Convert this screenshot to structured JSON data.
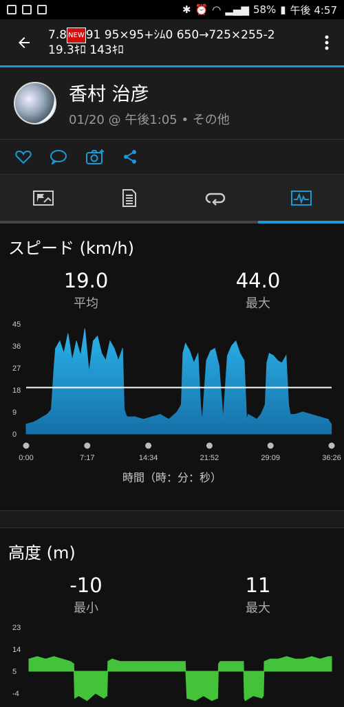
{
  "statusbar": {
    "battery": "58%",
    "time": "午後 4:57"
  },
  "appbar": {
    "title_line1_a": "7.8",
    "new_badge": "NEW",
    "title_line1_b": "91 95×95+ｼﾑ0 650→725×255-2",
    "title_line2": "19.3ｷﾛ 143ｷﾛ"
  },
  "profile": {
    "name": "香村 治彦",
    "meta": "01/20 @ 午後1:05 • その他"
  },
  "speed": {
    "title": "スピード (km/h)",
    "avg_value": "19.0",
    "avg_label": "平均",
    "max_value": "44.0",
    "max_label": "最大",
    "xaxis_title": "時間（時：分：秒）"
  },
  "altitude": {
    "title": "高度 (m)",
    "min_value": "-10",
    "min_label": "最小",
    "max_value": "11",
    "max_label": "最大"
  },
  "colors": {
    "accent": "#1a9ad6",
    "speed_fill": "#1a9ad6",
    "alt_fill": "#44c23a"
  },
  "chart_data": [
    {
      "type": "area",
      "ylim": [
        0,
        45
      ],
      "yticks": [
        "45",
        "36",
        "27",
        "18",
        "9",
        "0"
      ],
      "xticks": [
        "0:00",
        "7:17",
        "14:34",
        "21:52",
        "29:09",
        "36:26"
      ],
      "average_line": 19,
      "xmax": 36.43,
      "x": [
        0,
        1,
        2,
        2.5,
        3,
        3.3,
        3.5,
        4,
        4.5,
        5,
        5.5,
        6,
        6.5,
        7,
        7.5,
        8,
        8.5,
        9,
        9.5,
        10,
        10.5,
        11,
        11.5,
        11.7,
        12,
        13,
        14,
        15,
        16,
        17,
        18,
        18.5,
        18.7,
        19,
        19.5,
        20,
        20.5,
        20.8,
        21,
        21.5,
        22,
        22.5,
        23,
        23.5,
        24,
        24.5,
        25,
        25.5,
        26,
        26.3,
        26.5,
        27,
        27.5,
        28,
        28.5,
        28.7,
        29,
        29.5,
        30,
        30.5,
        31,
        31.3,
        31.5,
        32,
        33,
        34,
        35,
        36,
        36.4
      ],
      "values": [
        4,
        5,
        7,
        8,
        10,
        26,
        35,
        38,
        33,
        41,
        30,
        38,
        32,
        43,
        25,
        38,
        40,
        33,
        30,
        38,
        35,
        30,
        35,
        10,
        7,
        7,
        6,
        7,
        8,
        6,
        9,
        12,
        33,
        37,
        34,
        29,
        33,
        12,
        5,
        30,
        34,
        35,
        28,
        6,
        32,
        36,
        38,
        33,
        30,
        6,
        8,
        7,
        6,
        8,
        12,
        29,
        33,
        32,
        30,
        29,
        32,
        12,
        8,
        8,
        9,
        8,
        7,
        6,
        4
      ]
    },
    {
      "type": "area",
      "ylim": [
        -4,
        23
      ],
      "yticks": [
        "23",
        "14",
        "5",
        "-4"
      ],
      "x": [
        0,
        1,
        2,
        3,
        4,
        5,
        5.4,
        5.5,
        6,
        7,
        8,
        9,
        9.4,
        9.5,
        10,
        11,
        12,
        13,
        14,
        15,
        16,
        17,
        18,
        18.8,
        19,
        20,
        21,
        22,
        22.7,
        22.8,
        23,
        24,
        25,
        25.8,
        25.9,
        26,
        27,
        28,
        28.2,
        28.3,
        29,
        30,
        31,
        32,
        33,
        34,
        35,
        36,
        36.4
      ],
      "values": [
        10,
        11,
        10,
        11,
        10,
        9,
        8,
        -6,
        -5,
        -7,
        -4,
        -6,
        -5,
        9,
        10,
        9,
        9,
        9,
        9,
        9,
        9,
        9,
        9,
        9,
        -6,
        -7,
        -5,
        -7,
        -6,
        8,
        9,
        9,
        9,
        9,
        -6,
        -7,
        -5,
        -6,
        -5,
        9,
        10,
        10,
        11,
        10,
        10,
        11,
        10,
        11,
        11
      ]
    }
  ]
}
